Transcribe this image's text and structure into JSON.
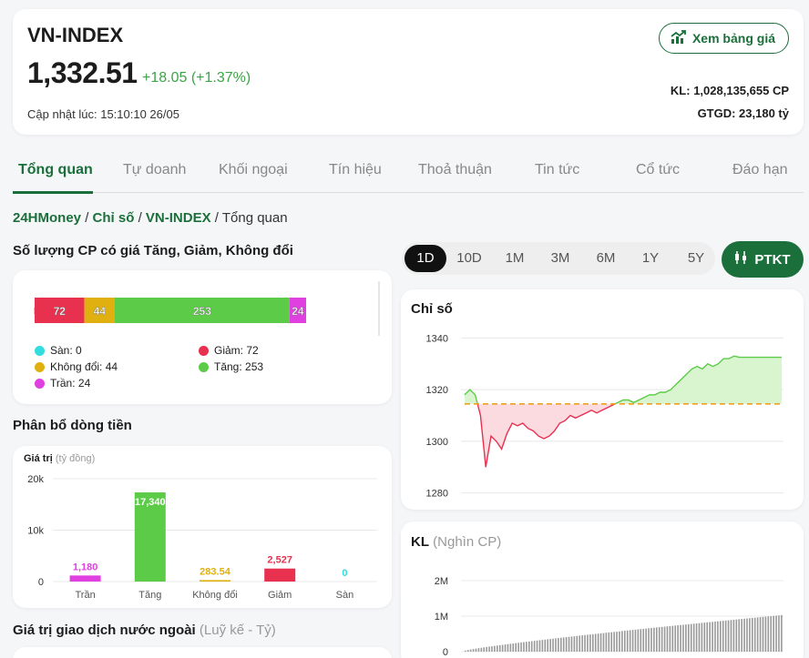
{
  "header": {
    "name": "VN-INDEX",
    "value": "1,332.51",
    "change": "+18.05 (+1.37%)",
    "updated": "Cập nhật lúc: 15:10:10 26/05",
    "board_button": "Xem bảng giá",
    "kl": "KL: 1,028,135,655 CP",
    "gtgd": "GTGD: 23,180 tỷ"
  },
  "tabs": [
    "Tổng quan",
    "Tự doanh",
    "Khối ngoại",
    "Tín hiệu",
    "Thoả thuận",
    "Tin tức",
    "Cổ tức",
    "Đáo hạn"
  ],
  "breadcrumb": {
    "home": "24HMoney",
    "section": "Chỉ số",
    "index": "VN-INDEX",
    "sep": "/",
    "current": "Tổng quan"
  },
  "stock_count": {
    "title": "Số lượng CP có giá Tăng, Giảm, Không đổi",
    "segments": [
      {
        "key": "san",
        "value": 0,
        "label": "0"
      },
      {
        "key": "giam",
        "value": 72,
        "label": "72"
      },
      {
        "key": "khongdoi",
        "value": 44,
        "label": "44"
      },
      {
        "key": "tang",
        "value": 253,
        "label": "253"
      },
      {
        "key": "tran",
        "value": 24,
        "label": "24"
      }
    ],
    "legend": {
      "san": "Sàn: 0",
      "giam": "Giảm: 72",
      "khongdoi": "Không đổi: 44",
      "tang": "Tăng: 253",
      "tran": "Trần: 24"
    }
  },
  "flow": {
    "title": "Phân bổ dòng tiền",
    "ylabel": "Giá trị",
    "yunit": "(tỷ đồng)"
  },
  "foreign": {
    "title": "Giá trị giao dịch nước ngoài",
    "sub": "(Luỹ kế - Tỷ)"
  },
  "ranges": [
    "1D",
    "10D",
    "1M",
    "3M",
    "6M",
    "1Y",
    "5Y"
  ],
  "ptkt_label": "PTKT",
  "index_chart_title": "Chỉ số",
  "kl_chart": {
    "title": "KL",
    "unit": "(Nghìn CP)"
  },
  "colors": {
    "brand": "#1b6f3b",
    "up": "#5ccc48",
    "down": "#e8304f",
    "flat": "#e0b010",
    "ceiling": "#e040e0",
    "floor": "#33dddd"
  },
  "icons": {
    "board": "chart-up-icon",
    "ptkt": "candlestick-icon"
  },
  "chart_data": [
    {
      "type": "bar",
      "title": "Phân bổ dòng tiền",
      "ylabel": "Giá trị",
      "categories": [
        "Trần",
        "Tăng",
        "Không đổi",
        "Giảm",
        "Sàn"
      ],
      "values": [
        1180,
        17340,
        283.54,
        2527,
        0
      ],
      "value_labels": [
        "1,180",
        "17,340",
        "283.54",
        "2,527",
        "0"
      ],
      "colors": [
        "#e040e0",
        "#5ccc48",
        "#e0b010",
        "#e8304f",
        "#33dddd"
      ],
      "ylim": [
        0,
        20000
      ],
      "yticks": [
        0,
        10000,
        20000
      ],
      "ytick_labels": [
        "0",
        "10k",
        "20k"
      ]
    },
    {
      "type": "line",
      "title": "Chỉ số",
      "reference": 1314.46,
      "ylim": [
        1276,
        1344
      ],
      "yticks": [
        1280,
        1300,
        1320,
        1340
      ],
      "x": [
        0,
        1,
        2,
        3,
        4,
        5,
        6,
        7,
        8,
        9,
        10,
        11,
        12,
        13,
        14,
        15,
        16,
        17,
        18,
        19,
        20,
        21,
        22,
        23,
        24,
        25,
        26,
        27,
        28,
        29,
        30,
        31,
        32,
        33,
        34,
        35,
        36,
        37,
        38,
        39,
        40,
        41,
        42,
        43,
        44,
        45,
        46,
        47,
        48,
        49,
        50,
        51,
        52,
        53,
        54,
        55,
        56,
        57,
        58,
        59,
        60
      ],
      "values": [
        1318,
        1320,
        1318,
        1310,
        1290,
        1302,
        1300,
        1297,
        1303,
        1307,
        1306,
        1307,
        1305,
        1304,
        1302,
        1301,
        1302,
        1304,
        1307,
        1308,
        1310,
        1309,
        1310,
        1311,
        1312,
        1311,
        1312,
        1313,
        1314,
        1315,
        1316,
        1316,
        1315,
        1316,
        1317,
        1318,
        1318,
        1319,
        1319,
        1320,
        1322,
        1324,
        1326,
        1328,
        1329,
        1328,
        1330,
        1329,
        1330,
        1332,
        1332,
        1333,
        1332.5,
        1332.5,
        1332.5,
        1332.5,
        1332.5,
        1332.5,
        1332.5,
        1332.5,
        1332.51
      ]
    },
    {
      "type": "bar",
      "title": "KL",
      "ylim": [
        0,
        2000000
      ],
      "yticks": [
        0,
        1000000,
        2000000
      ],
      "ytick_labels": [
        "0",
        "1M",
        "2M"
      ],
      "x_count": 120,
      "start": 30000,
      "end": 1028135
    }
  ]
}
